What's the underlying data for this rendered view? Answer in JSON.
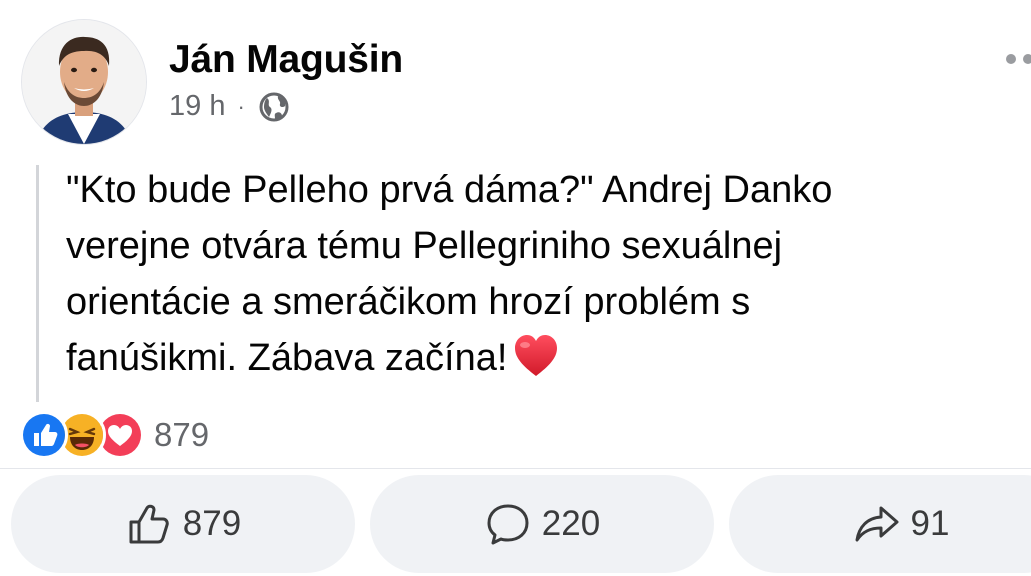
{
  "author": {
    "name": "Ján Magušin",
    "time": "19 h",
    "separator": "·",
    "audience_icon": "globe-icon"
  },
  "post": {
    "text": "\"Kto bude Pelleho prvá dáma?\" Andrej Danko\nverejne otvára tému Pellegriniho sexuálnej\norientácie a smeráčikom hrozí problém s\nfanúšikmi. Zábava začína!",
    "emoji": "red-heart-emoji"
  },
  "reactions": {
    "icons": [
      "like-reaction-icon",
      "haha-reaction-icon",
      "love-reaction-icon"
    ],
    "count": "879"
  },
  "actions": {
    "like_count": "879",
    "comment_count": "220",
    "share_count": "91"
  },
  "colors": {
    "like_blue": "#1877f2",
    "love_red": "#f33e58",
    "haha_yellow": "#f7b125",
    "secondary_text": "#65676b",
    "button_bg": "#f0f2f5"
  }
}
